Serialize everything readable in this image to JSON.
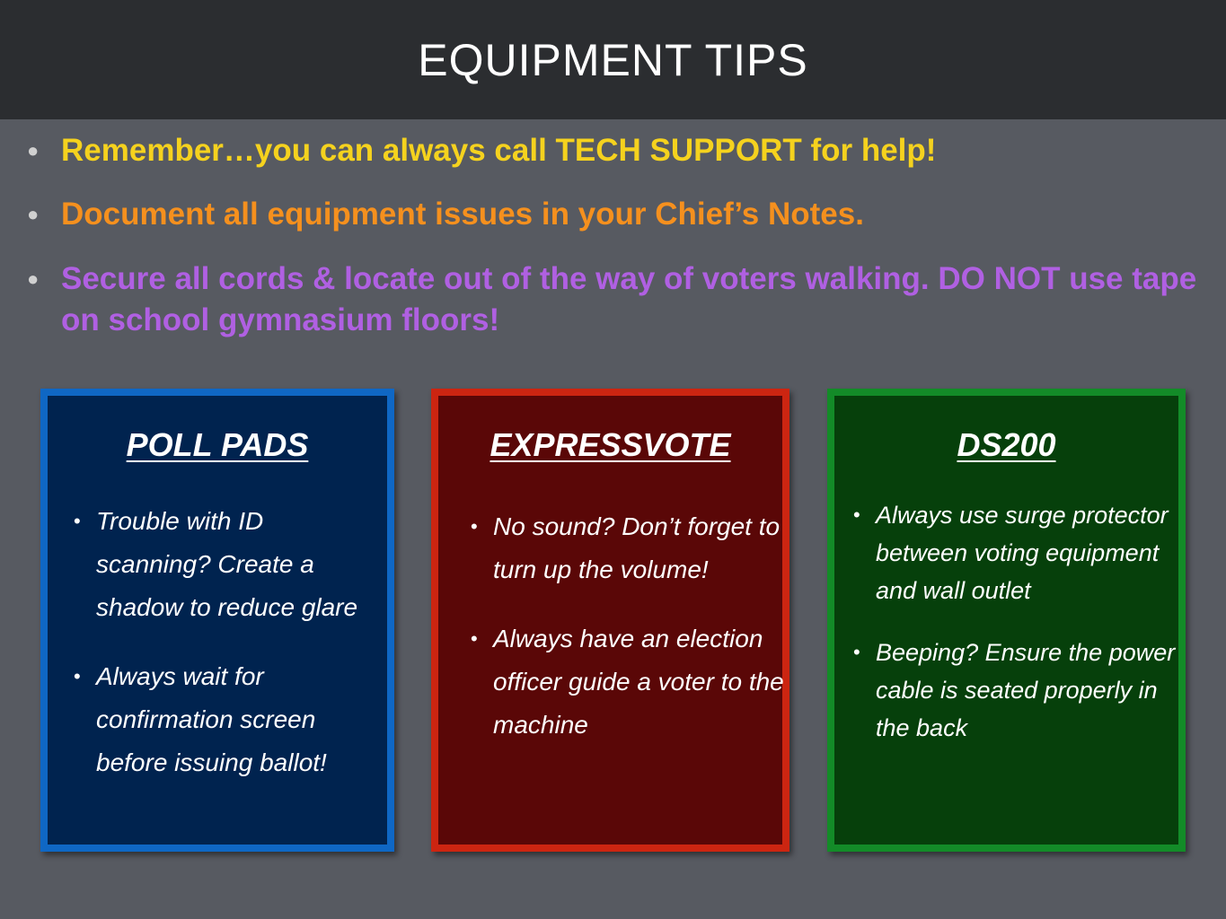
{
  "header": {
    "title": "EQUIPMENT TIPS"
  },
  "colors": {
    "tip_yellow": "#f5d21e",
    "tip_orange": "#f5901e",
    "tip_purple": "#b060e2"
  },
  "tips": [
    {
      "text": "Remember…you can always call TECH SUPPORT for help!",
      "color": "#f5d21e"
    },
    {
      "text": "Document all equipment issues in your Chief’s Notes.",
      "color": "#f5901e"
    },
    {
      "text": "Secure all cords & locate out of the way of voters walking. DO NOT use tape on school gymnasium floors!",
      "color": "#b060e2"
    }
  ],
  "cards": [
    {
      "title": "POLL PADS",
      "items": [
        "Trouble with ID scanning? Create a shadow to reduce glare",
        "Always wait for confirmation screen before issuing ballot!"
      ]
    },
    {
      "title": "EXPRESSVOTE",
      "items": [
        "No sound? Don’t forget to turn up the volume!",
        "Always have an election officer guide a voter to the machine"
      ]
    },
    {
      "title": "DS200",
      "items": [
        "Always use surge protector between voting equipment and wall outlet",
        "Beeping? Ensure the power cable is seated properly in the back"
      ]
    }
  ]
}
